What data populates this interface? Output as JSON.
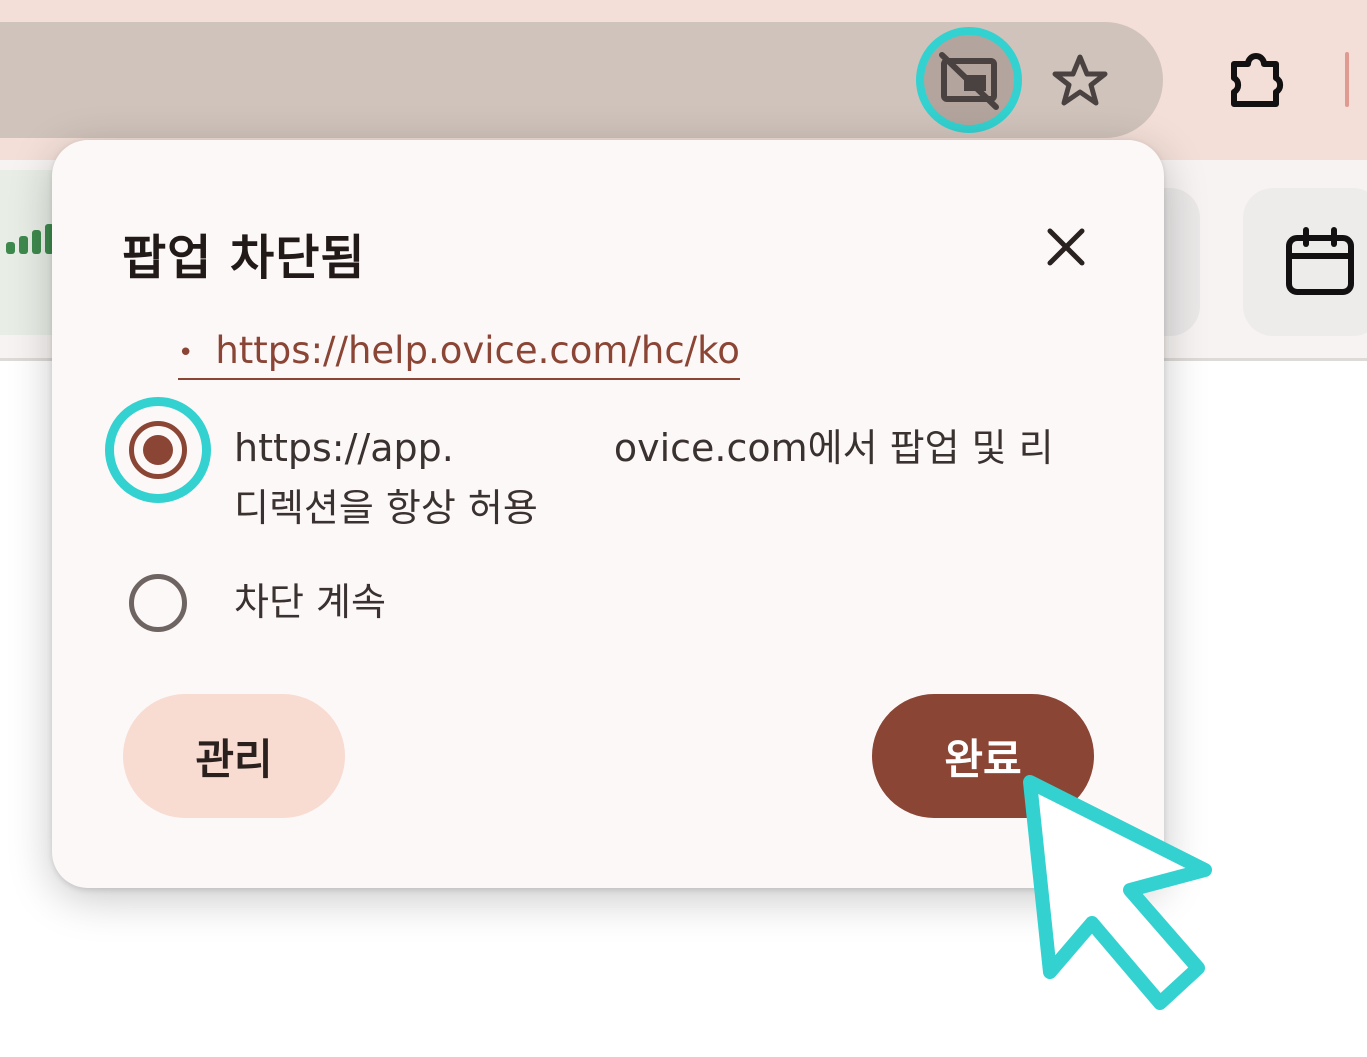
{
  "dialog": {
    "title": "팝업 차단됨",
    "blocked_link": "https://help.ovice.com/hc/ko",
    "option_allow_line1_prefix": "https://app.",
    "option_allow_line1_suffix": "ovice.com에서 팝업 및 리",
    "option_allow_line2": "디렉션을 항상 허용",
    "option_block": "차단 계속",
    "manage_button": "관리",
    "done_button": "완료"
  },
  "selected_option": "allow",
  "icons": {
    "popup_blocked": "popup-blocked-icon",
    "bookmark": "star-icon",
    "extensions": "puzzle-icon",
    "calendar": "calendar-icon",
    "close": "close-icon",
    "signal": "signal-bars-icon",
    "cursor": "mouse-pointer-icon"
  },
  "colors": {
    "accent": "#8a4535",
    "highlight": "#33d1cf",
    "manage_button_bg": "#f8dbd1",
    "chrome_bg": "#f3dfd7",
    "address_bar": "#d0c3bb"
  }
}
